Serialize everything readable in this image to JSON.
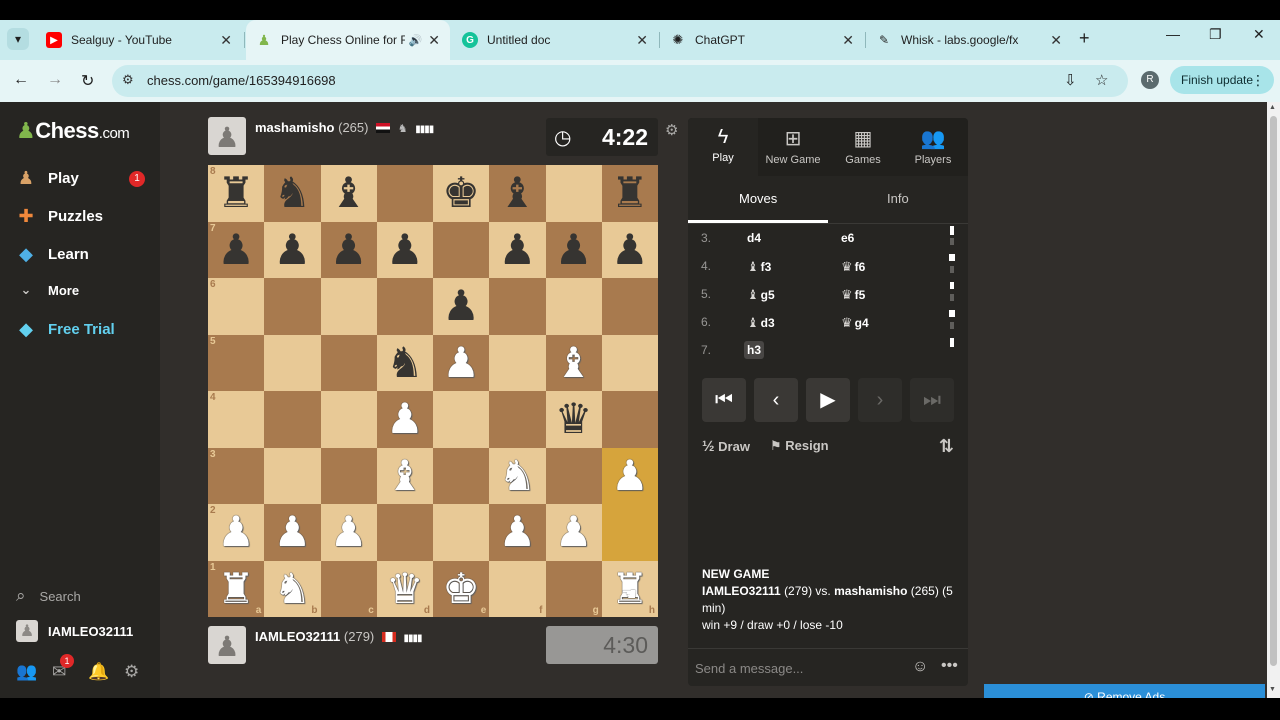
{
  "browser": {
    "tabs": [
      {
        "title": "Sealguy - YouTube",
        "favicon": "youtube-icon",
        "color": "#ff0000"
      },
      {
        "title": "Play Chess Online for FRE",
        "favicon": "chess-pawn-icon",
        "color": "#81b64c",
        "active": true
      },
      {
        "title": "Untitled doc",
        "favicon": "grammarly-icon",
        "color": "#15c39a"
      },
      {
        "title": "ChatGPT",
        "favicon": "chatgpt-icon",
        "color": "#1f1f1f"
      },
      {
        "title": "Whisk - labs.google/fx",
        "favicon": "whisk-icon",
        "color": "#1f1f1f"
      }
    ],
    "url": "chess.com/game/165394916698",
    "profile_initial": "R",
    "finish_update": "Finish update"
  },
  "sidebar": {
    "logo_text": "Chess",
    "logo_suffix": ".com",
    "items": [
      {
        "label": "Play",
        "icon": "play-pawn-icon",
        "badge": "1"
      },
      {
        "label": "Puzzles",
        "icon": "puzzle-icon"
      },
      {
        "label": "Learn",
        "icon": "learn-cap-icon"
      },
      {
        "label": "More",
        "icon": "chevron-down-icon"
      },
      {
        "label": "Free Trial",
        "icon": "diamond-icon"
      }
    ],
    "search_label": "Search",
    "username": "IAMLEO32111",
    "messages_badge": "1"
  },
  "game": {
    "top_player": {
      "name": "mashamisho",
      "rating": "(265)"
    },
    "bottom_player": {
      "name": "IAMLEO32111",
      "rating": "(279)"
    },
    "top_clock": "4:22",
    "bottom_clock": "4:30",
    "board": [
      [
        "bR",
        "bN",
        "bB",
        "",
        "bK",
        "bB",
        "",
        "bR"
      ],
      [
        "bP",
        "bP",
        "bP",
        "bP",
        "",
        "bP",
        "bP",
        "bP"
      ],
      [
        "",
        "",
        "",
        "",
        "bP",
        "",
        "",
        ""
      ],
      [
        "",
        "",
        "",
        "bN",
        "wP",
        "",
        "wB",
        ""
      ],
      [
        "",
        "",
        "",
        "wP",
        "",
        "",
        "bQ",
        ""
      ],
      [
        "",
        "",
        "",
        "wB",
        "",
        "wN",
        "",
        "wP"
      ],
      [
        "wP",
        "wP",
        "wP",
        "",
        "",
        "wP",
        "wP",
        ""
      ],
      [
        "wR",
        "wN",
        "",
        "wQ",
        "wK",
        "",
        "",
        "wR"
      ]
    ],
    "highlight": [
      "h3",
      "h2"
    ],
    "files": [
      "a",
      "b",
      "c",
      "d",
      "e",
      "f",
      "g",
      "h"
    ],
    "ranks": [
      "8",
      "7",
      "6",
      "5",
      "4",
      "3",
      "2",
      "1"
    ]
  },
  "panel": {
    "tabs": [
      {
        "label": "Play",
        "icon": "lightning-icon"
      },
      {
        "label": "New Game",
        "icon": "plus-square-icon"
      },
      {
        "label": "Games",
        "icon": "board-icon"
      },
      {
        "label": "Players",
        "icon": "players-icon"
      }
    ],
    "subtabs": [
      "Moves",
      "Info"
    ],
    "moves": [
      {
        "n": "3.",
        "w": "d4",
        "b": "e6"
      },
      {
        "n": "4.",
        "wp": "♝",
        "w": "f3",
        "bp": "♛",
        "b": "f6"
      },
      {
        "n": "5.",
        "wp": "♝",
        "w": "g5",
        "bp": "♛",
        "b": "f5"
      },
      {
        "n": "6.",
        "wp": "♝",
        "w": "d3",
        "bp": "♛",
        "b": "g4"
      },
      {
        "n": "7.",
        "w": "h3",
        "b": ""
      }
    ],
    "draw_label": "Draw",
    "draw_glyph": "½",
    "resign_label": "Resign",
    "new_game_title": "NEW GAME",
    "new_game_white": "IAMLEO32111",
    "new_game_white_rating": "(279) vs.",
    "new_game_black": "mashamisho",
    "new_game_black_rating": "(265) (5 min)",
    "new_game_result": "win +9 / draw +0 / lose -10",
    "chat_placeholder": "Send a message...",
    "remove_ads": "Remove Ads"
  }
}
